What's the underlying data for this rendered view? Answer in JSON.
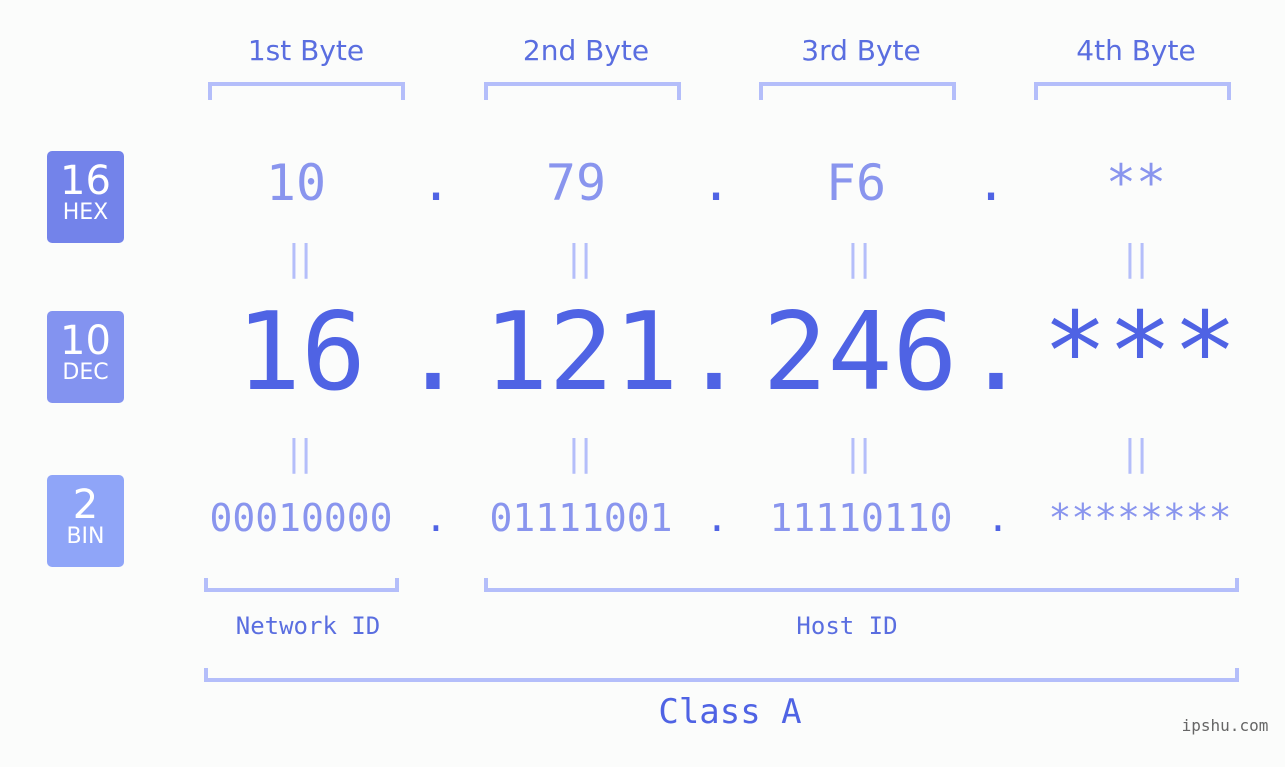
{
  "bytes": [
    {
      "header": "1st Byte",
      "hex": "10",
      "dec": "16",
      "bin": "00010000"
    },
    {
      "header": "2nd Byte",
      "hex": "79",
      "dec": "121",
      "bin": "01111001"
    },
    {
      "header": "3rd Byte",
      "hex": "F6",
      "dec": "246",
      "bin": "11110110"
    },
    {
      "header": "4th Byte",
      "hex": "**",
      "dec": "***",
      "bin": "********"
    }
  ],
  "separator": ".",
  "equals": "||",
  "badges": {
    "hex": {
      "num": "16",
      "label": "HEX",
      "color": "#7383ea"
    },
    "dec": {
      "num": "10",
      "label": "DEC",
      "color": "#8393f0"
    },
    "bin": {
      "num": "2",
      "label": "BIN",
      "color": "#8fa5f8"
    }
  },
  "labels": {
    "network_id": "Network ID",
    "host_id": "Host ID",
    "class": "Class A"
  },
  "watermark": "ipshu.com"
}
